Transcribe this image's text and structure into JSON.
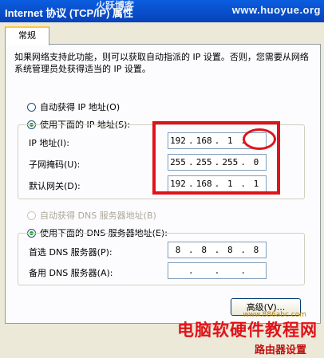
{
  "window": {
    "title": "Internet 协议 (TCP/IP) 属性",
    "watermark_url": "www.huoyue.org",
    "watermark_cn": "火跃博客"
  },
  "tab": {
    "label": "常规"
  },
  "description": "如果网络支持此功能，则可以获取自动指派的 IP 设置。否则，您需要从网络系统管理员处获得适当的 IP 设置。",
  "ip_section": {
    "auto_label": "自动获得 IP 地址(O)",
    "manual_label": "使用下面的 IP 地址(S):",
    "selected": "manual",
    "fields": [
      {
        "label": "IP 地址(I):",
        "octets": [
          "192",
          "168",
          "1",
          ""
        ]
      },
      {
        "label": "子网掩码(U):",
        "octets": [
          "255",
          "255",
          "255",
          "0"
        ]
      },
      {
        "label": "默认网关(D):",
        "octets": [
          "192",
          "168",
          "1",
          "1"
        ]
      }
    ]
  },
  "dns_section": {
    "auto_label": "自动获得 DNS 服务器地址(B)",
    "manual_label": "使用下面的 DNS 服务器地址(E):",
    "selected": "manual",
    "fields": [
      {
        "label": "首选 DNS 服务器(P):",
        "octets": [
          "8",
          "8",
          "8",
          "8"
        ]
      },
      {
        "label": "备用 DNS 服务器(A):",
        "octets": [
          "",
          "",
          "",
          ""
        ]
      }
    ]
  },
  "buttons": {
    "advanced": "高级(V)..."
  },
  "footer_watermark": {
    "line1": "电脑软硬件教程网",
    "line2": "路由器设置",
    "url": "www.886abc.com"
  },
  "colors": {
    "annotation_red": "#e0131a",
    "title_blue": "#0a5ee0"
  }
}
